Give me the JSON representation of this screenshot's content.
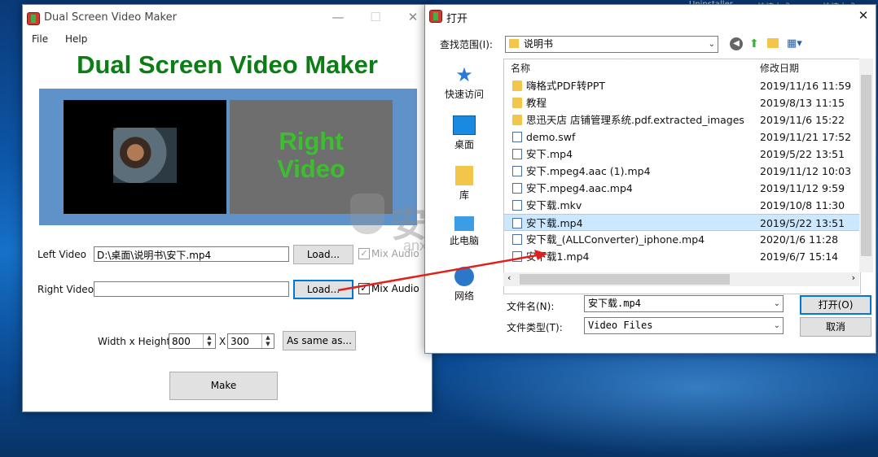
{
  "desktop": {
    "top_texts": [
      "Uninstaller",
      "快捷方式",
      "快捷方式"
    ]
  },
  "app": {
    "title": "Dual Screen Video Maker",
    "menu": [
      "File",
      "Help"
    ],
    "heading": "Dual Screen Video Maker",
    "right_preview": [
      "Right",
      "Video"
    ],
    "left_video_label": "Left Video",
    "left_video_value": "D:\\桌面\\说明书\\安下.mp4",
    "right_video_label": "Right Video",
    "right_video_value": "",
    "load_label": "Load...",
    "mix_audio_label": "Mix Audio",
    "size_label": "Width x Height",
    "width_value": "800",
    "x_label": "X",
    "height_value": "300",
    "same_as_label": "As same as...",
    "make_label": "Make"
  },
  "dialog": {
    "title": "打开",
    "lookin_label": "查找范围(I):",
    "lookin_value": "说明书",
    "places": [
      "快速访问",
      "桌面",
      "库",
      "此电脑",
      "网络"
    ],
    "col_name": "名称",
    "col_date": "修改日期",
    "files": [
      {
        "name": "嗨格式PDF转PPT",
        "date": "2019/11/16 11:59",
        "type": "folder"
      },
      {
        "name": "教程",
        "date": "2019/8/13 11:15",
        "type": "folder"
      },
      {
        "name": "思迅天店 店铺管理系统.pdf.extracted_images",
        "date": "2019/11/6 15:22",
        "type": "folder"
      },
      {
        "name": "demo.swf",
        "date": "2019/11/21 17:52",
        "type": "file"
      },
      {
        "name": "安下.mp4",
        "date": "2019/5/22 13:51",
        "type": "file"
      },
      {
        "name": "安下.mpeg4.aac (1).mp4",
        "date": "2019/11/12 10:03",
        "type": "file"
      },
      {
        "name": "安下.mpeg4.aac.mp4",
        "date": "2019/11/12 9:59",
        "type": "file"
      },
      {
        "name": "安下载.mkv",
        "date": "2019/10/8 11:30",
        "type": "file"
      },
      {
        "name": "安下载.mp4",
        "date": "2019/5/22 13:51",
        "type": "file",
        "selected": true
      },
      {
        "name": "安下载_(ALLConverter)_iphone.mp4",
        "date": "2020/1/6 11:28",
        "type": "file"
      },
      {
        "name": "安下载1.mp4",
        "date": "2019/6/7 15:14",
        "type": "file"
      }
    ],
    "filename_label": "文件名(N):",
    "filename_value": "安下载.mp4",
    "filetype_label": "文件类型(T):",
    "filetype_value": "Video Files",
    "open_label": "打开(O)",
    "cancel_label": "取消"
  },
  "watermark": {
    "text": "安下载",
    "sub": "anxz.com"
  },
  "colors": {
    "accent": "#0078d7",
    "heading_green": "#0b7d14",
    "arrow": "#e0201c"
  }
}
